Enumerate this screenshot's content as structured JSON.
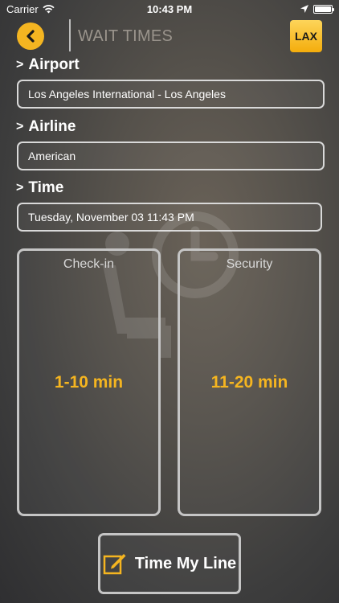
{
  "status_bar": {
    "carrier": "Carrier",
    "time": "10:43 PM",
    "battery_level": 1.0
  },
  "header": {
    "title": "WAIT TIMES",
    "airport_code": "LAX"
  },
  "sections": {
    "airport": {
      "label": "Airport",
      "value": "Los Angeles International - Los Angeles"
    },
    "airline": {
      "label": "Airline",
      "value": "American"
    },
    "time": {
      "label": "Time",
      "value": "Tuesday, November 03 11:43 PM"
    }
  },
  "cards": {
    "checkin": {
      "title": "Check-in",
      "value": "1-10 min"
    },
    "security": {
      "title": "Security",
      "value": "11-20 min"
    }
  },
  "action": {
    "label": "Time My Line"
  },
  "colors": {
    "accent": "#f5b520",
    "border": "#c5c5c5"
  },
  "icons": [
    "wifi-icon",
    "back-arrow-icon",
    "location-arrow-icon",
    "battery-icon",
    "chevron-right-icon",
    "edit-icon",
    "seat-clock-watermark-icon"
  ]
}
